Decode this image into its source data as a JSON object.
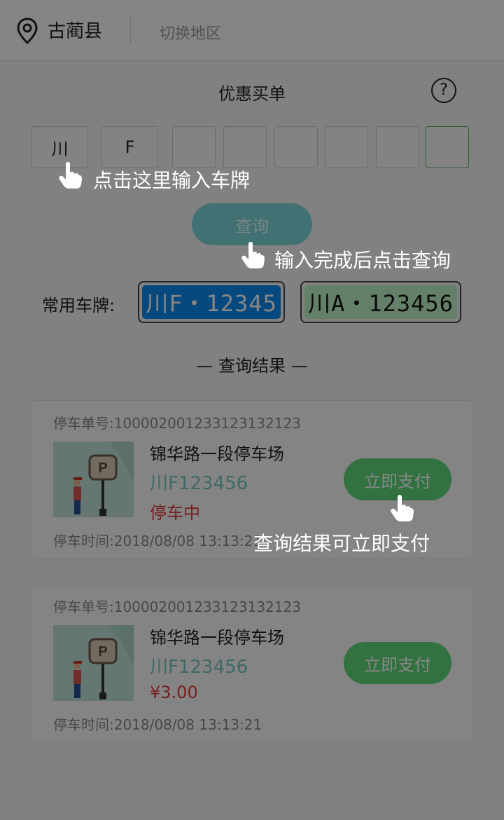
{
  "header": {
    "city": "古蔺县",
    "switch_label": "切换地区"
  },
  "page_title": "优惠买单",
  "help_symbol": "?",
  "plate_inputs": [
    "川",
    "F",
    "",
    "",
    "",
    "",
    "",
    ""
  ],
  "hints": {
    "plate_input": "点击这里输入车牌",
    "query": "输入完成后点击查询",
    "pay": "查询结果可立即支付"
  },
  "query_button": "查询",
  "common_plates": {
    "label": "常用车牌:",
    "items": [
      "川F・12345",
      "川A・123456"
    ]
  },
  "result_title": "—   查询结果   —",
  "results": [
    {
      "order": "停车单号:10000200123312313212​3",
      "lot": "锦华路一段停车场",
      "plate": "川F123456",
      "status": "停车中",
      "time": "停车时间:2018/08/08 13:13:21",
      "pay": "立即支付"
    },
    {
      "order": "停车单号:10000200123312313212​3",
      "lot": "锦华路一段停车场",
      "plate": "川F123456",
      "status": "¥3.00",
      "time": "停车时间:2018/08/08 13:13:21",
      "pay": "立即支付"
    }
  ],
  "colors": {
    "accent_teal": "#7ed5d9",
    "pay_green": "#5fd57a",
    "plate_blue": "#0a8bf0",
    "plate_green": "#bff2c4",
    "status_red": "#e03b3b"
  }
}
